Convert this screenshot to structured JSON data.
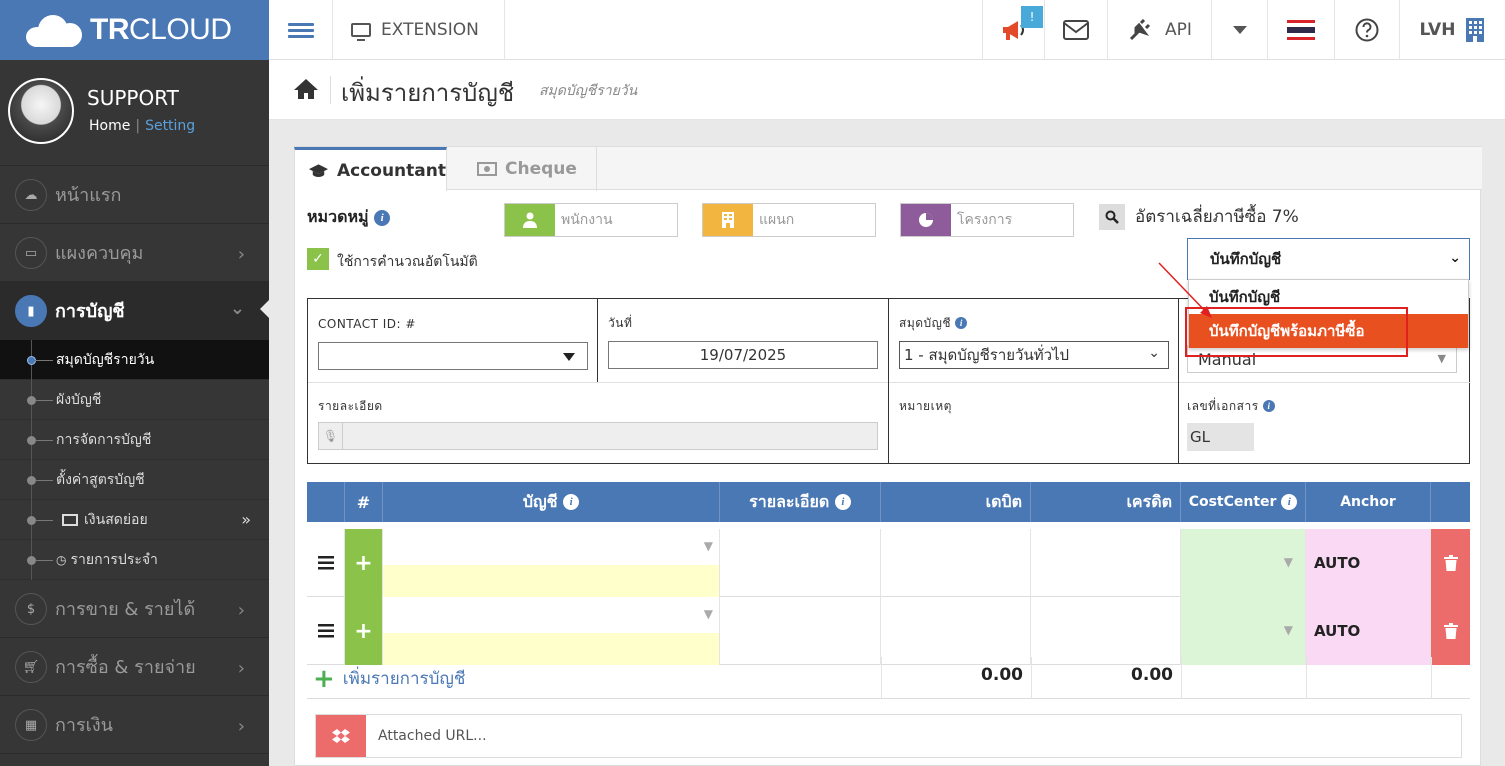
{
  "brand": {
    "bold": "TR",
    "rest": "CLOUD"
  },
  "topbar": {
    "extension": "EXTENSION",
    "notify_badge": "!",
    "api": "API",
    "user": "LVH"
  },
  "profile": {
    "name": "SUPPORT",
    "home": "Home",
    "sep": "|",
    "setting": "Setting"
  },
  "sidebar": {
    "home": "หน้าแรก",
    "dashboard": "แผงควบคุม",
    "accounting": "การบัญชี",
    "sub": [
      "สมุดบัญชีรายวัน",
      "ผังบัญชี",
      "การจัดการบัญชี",
      "ตั้งค่าสูตรบัญชี",
      "เงินสดย่อย",
      "รายการประจำ"
    ],
    "sales": "การขาย & รายได้",
    "purchase": "การซื้อ & รายจ่าย",
    "finance": "การเงิน"
  },
  "page": {
    "title": "เพิ่มรายการบัญชี",
    "subtitle": "สมุดบัญชีรายวัน"
  },
  "tabs": [
    "Accountant",
    "Cheque"
  ],
  "form": {
    "category_label": "หมวดหมู่",
    "employee_ph": "พนักงาน",
    "department_ph": "แผนก",
    "project_ph": "โครงการ",
    "vat_text": "อัตราเฉลี่ยภาษีซื้อ 7%",
    "auto_calc": "ใช้การคำนวณอัตโนมัติ",
    "save_select": "บันทึกบัญชี",
    "dropdown_options": [
      "บันทึกบัญชี",
      "บันทึกบัญชีพร้อมภาษีซื้อ"
    ],
    "contact_label": "CONTACT ID: #",
    "date_label": "วันที่",
    "date_value": "19/07/2025",
    "journal_label": "สมุดบัญชี",
    "journal_value": "1 - สมุดบัญชีรายวันทั่วไป",
    "manual_value": "Manual",
    "detail_label": "รายละเอียด",
    "note_label": "หมายเหตุ",
    "docno_label": "เลขที่เอกสาร",
    "docno_value": "GL"
  },
  "table": {
    "headers": [
      "#",
      "บัญชี",
      "รายละเอียด",
      "เดบิต",
      "เครดิต",
      "CostCenter",
      "Anchor"
    ],
    "rows": [
      {
        "anchor": "AUTO"
      },
      {
        "anchor": "AUTO"
      }
    ],
    "add_line": "เพิ่มรายการบัญชี",
    "total_debit": "0.00",
    "total_credit": "0.00"
  },
  "attach": {
    "placeholder": "Attached URL..."
  },
  "colors": {
    "brand_blue": "#4a78b5",
    "green": "#8bc34a",
    "orange": "#e8501f",
    "red": "#ec6b6b"
  }
}
